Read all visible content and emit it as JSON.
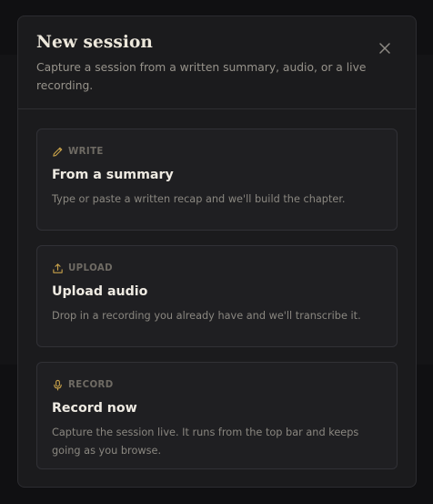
{
  "modal": {
    "title": "New session",
    "subtitle": "Capture a session from a written summary, audio, or a live recording.",
    "close_icon": "close-icon"
  },
  "options": [
    {
      "tag": "WRITE",
      "icon": "pencil-icon",
      "title": "From a summary",
      "description": "Type or paste a written recap and we'll build the chapter."
    },
    {
      "tag": "UPLOAD",
      "icon": "upload-icon",
      "title": "Upload audio",
      "description": "Drop in a recording you already have and we'll transcribe it."
    },
    {
      "tag": "RECORD",
      "icon": "microphone-icon",
      "title": "Record now",
      "description": "Capture the session live. It runs from the top bar and keeps going as you browse."
    }
  ],
  "colors": {
    "accent_gold": "#c9a24a",
    "background": "#101012",
    "modal_bg": "#1b1b1d"
  }
}
